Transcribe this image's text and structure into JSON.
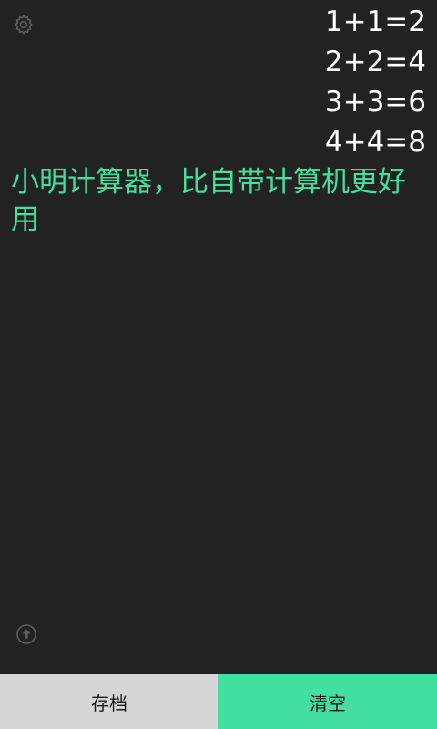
{
  "toolbar": {
    "settings_icon": "gear-icon",
    "share_icon": "upload-arrow-icon"
  },
  "history": [
    "1+1=2",
    "2+2=4",
    "3+3=6",
    "4+4=8"
  ],
  "display": {
    "text": "小明计算器，比自带计算机更好用"
  },
  "buttons": {
    "save_label": "存档",
    "clear_label": "清空"
  },
  "colors": {
    "background": "#222222",
    "accent": "#43df9f",
    "save_button": "#d6d6d6"
  }
}
